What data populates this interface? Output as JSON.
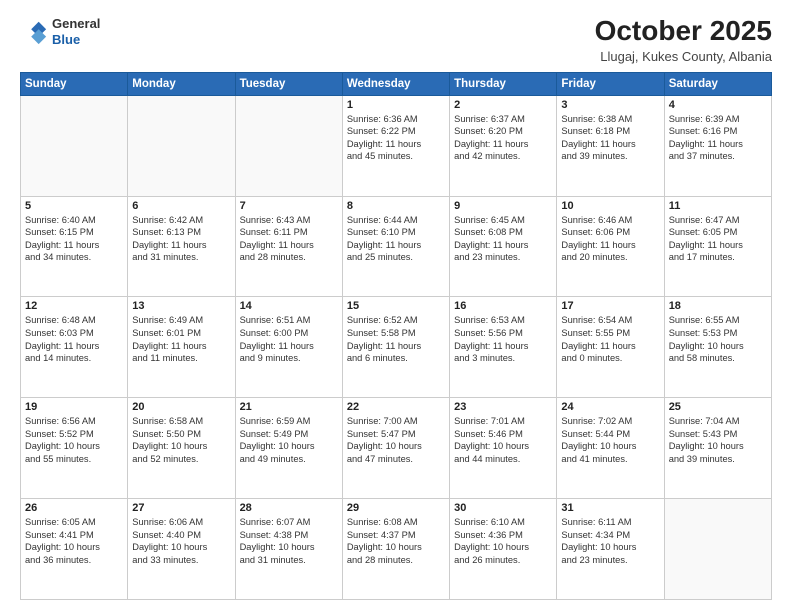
{
  "header": {
    "logo_line1": "General",
    "logo_line2": "Blue",
    "month_year": "October 2025",
    "location": "Llugaj, Kukes County, Albania"
  },
  "days_of_week": [
    "Sunday",
    "Monday",
    "Tuesday",
    "Wednesday",
    "Thursday",
    "Friday",
    "Saturday"
  ],
  "weeks": [
    [
      {
        "day": "",
        "info": ""
      },
      {
        "day": "",
        "info": ""
      },
      {
        "day": "",
        "info": ""
      },
      {
        "day": "1",
        "info": "Sunrise: 6:36 AM\nSunset: 6:22 PM\nDaylight: 11 hours\nand 45 minutes."
      },
      {
        "day": "2",
        "info": "Sunrise: 6:37 AM\nSunset: 6:20 PM\nDaylight: 11 hours\nand 42 minutes."
      },
      {
        "day": "3",
        "info": "Sunrise: 6:38 AM\nSunset: 6:18 PM\nDaylight: 11 hours\nand 39 minutes."
      },
      {
        "day": "4",
        "info": "Sunrise: 6:39 AM\nSunset: 6:16 PM\nDaylight: 11 hours\nand 37 minutes."
      }
    ],
    [
      {
        "day": "5",
        "info": "Sunrise: 6:40 AM\nSunset: 6:15 PM\nDaylight: 11 hours\nand 34 minutes."
      },
      {
        "day": "6",
        "info": "Sunrise: 6:42 AM\nSunset: 6:13 PM\nDaylight: 11 hours\nand 31 minutes."
      },
      {
        "day": "7",
        "info": "Sunrise: 6:43 AM\nSunset: 6:11 PM\nDaylight: 11 hours\nand 28 minutes."
      },
      {
        "day": "8",
        "info": "Sunrise: 6:44 AM\nSunset: 6:10 PM\nDaylight: 11 hours\nand 25 minutes."
      },
      {
        "day": "9",
        "info": "Sunrise: 6:45 AM\nSunset: 6:08 PM\nDaylight: 11 hours\nand 23 minutes."
      },
      {
        "day": "10",
        "info": "Sunrise: 6:46 AM\nSunset: 6:06 PM\nDaylight: 11 hours\nand 20 minutes."
      },
      {
        "day": "11",
        "info": "Sunrise: 6:47 AM\nSunset: 6:05 PM\nDaylight: 11 hours\nand 17 minutes."
      }
    ],
    [
      {
        "day": "12",
        "info": "Sunrise: 6:48 AM\nSunset: 6:03 PM\nDaylight: 11 hours\nand 14 minutes."
      },
      {
        "day": "13",
        "info": "Sunrise: 6:49 AM\nSunset: 6:01 PM\nDaylight: 11 hours\nand 11 minutes."
      },
      {
        "day": "14",
        "info": "Sunrise: 6:51 AM\nSunset: 6:00 PM\nDaylight: 11 hours\nand 9 minutes."
      },
      {
        "day": "15",
        "info": "Sunrise: 6:52 AM\nSunset: 5:58 PM\nDaylight: 11 hours\nand 6 minutes."
      },
      {
        "day": "16",
        "info": "Sunrise: 6:53 AM\nSunset: 5:56 PM\nDaylight: 11 hours\nand 3 minutes."
      },
      {
        "day": "17",
        "info": "Sunrise: 6:54 AM\nSunset: 5:55 PM\nDaylight: 11 hours\nand 0 minutes."
      },
      {
        "day": "18",
        "info": "Sunrise: 6:55 AM\nSunset: 5:53 PM\nDaylight: 10 hours\nand 58 minutes."
      }
    ],
    [
      {
        "day": "19",
        "info": "Sunrise: 6:56 AM\nSunset: 5:52 PM\nDaylight: 10 hours\nand 55 minutes."
      },
      {
        "day": "20",
        "info": "Sunrise: 6:58 AM\nSunset: 5:50 PM\nDaylight: 10 hours\nand 52 minutes."
      },
      {
        "day": "21",
        "info": "Sunrise: 6:59 AM\nSunset: 5:49 PM\nDaylight: 10 hours\nand 49 minutes."
      },
      {
        "day": "22",
        "info": "Sunrise: 7:00 AM\nSunset: 5:47 PM\nDaylight: 10 hours\nand 47 minutes."
      },
      {
        "day": "23",
        "info": "Sunrise: 7:01 AM\nSunset: 5:46 PM\nDaylight: 10 hours\nand 44 minutes."
      },
      {
        "day": "24",
        "info": "Sunrise: 7:02 AM\nSunset: 5:44 PM\nDaylight: 10 hours\nand 41 minutes."
      },
      {
        "day": "25",
        "info": "Sunrise: 7:04 AM\nSunset: 5:43 PM\nDaylight: 10 hours\nand 39 minutes."
      }
    ],
    [
      {
        "day": "26",
        "info": "Sunrise: 6:05 AM\nSunset: 4:41 PM\nDaylight: 10 hours\nand 36 minutes."
      },
      {
        "day": "27",
        "info": "Sunrise: 6:06 AM\nSunset: 4:40 PM\nDaylight: 10 hours\nand 33 minutes."
      },
      {
        "day": "28",
        "info": "Sunrise: 6:07 AM\nSunset: 4:38 PM\nDaylight: 10 hours\nand 31 minutes."
      },
      {
        "day": "29",
        "info": "Sunrise: 6:08 AM\nSunset: 4:37 PM\nDaylight: 10 hours\nand 28 minutes."
      },
      {
        "day": "30",
        "info": "Sunrise: 6:10 AM\nSunset: 4:36 PM\nDaylight: 10 hours\nand 26 minutes."
      },
      {
        "day": "31",
        "info": "Sunrise: 6:11 AM\nSunset: 4:34 PM\nDaylight: 10 hours\nand 23 minutes."
      },
      {
        "day": "",
        "info": ""
      }
    ]
  ]
}
